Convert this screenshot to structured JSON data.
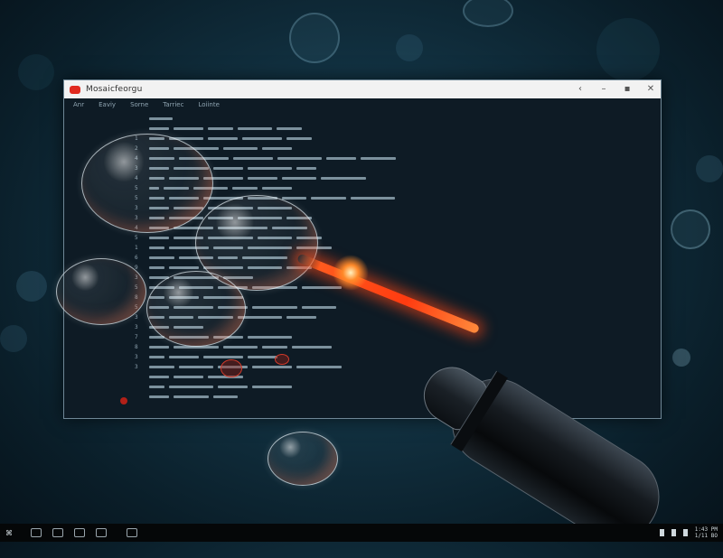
{
  "window": {
    "title": "Mosaicfeorgu",
    "controls": [
      "‹",
      "–",
      "▪",
      "✕"
    ],
    "menu": [
      "Anr",
      "Eaviy",
      "Sorne",
      "Tarriec",
      "Loiinte"
    ],
    "accent": "#e12a1f",
    "background": "#0e1b25"
  },
  "code_lines": [
    {
      "n": "",
      "segs": [
        48
      ]
    },
    {
      "n": "",
      "segs": [
        40,
        60,
        50,
        70,
        50
      ]
    },
    {
      "n": "1",
      "segs": [
        30,
        70,
        60,
        80,
        50
      ]
    },
    {
      "n": "2",
      "segs": [
        40,
        90,
        70,
        60
      ]
    },
    {
      "n": "4",
      "segs": [
        50,
        100,
        80,
        90,
        60,
        70
      ]
    },
    {
      "n": "3",
      "segs": [
        40,
        70,
        60,
        90,
        40
      ]
    },
    {
      "n": "4",
      "segs": [
        30,
        60,
        80,
        60,
        70,
        90
      ]
    },
    {
      "n": "5",
      "segs": [
        20,
        50,
        70,
        50,
        60
      ]
    },
    {
      "n": "5",
      "segs": [
        30,
        60,
        80,
        60,
        50,
        70,
        90
      ]
    },
    {
      "n": "3",
      "segs": [
        40,
        60,
        90,
        70
      ]
    },
    {
      "n": "3",
      "segs": [
        30,
        70,
        50,
        90,
        50
      ]
    },
    {
      "n": "4",
      "segs": [
        40,
        80,
        100,
        70
      ]
    },
    {
      "n": "5",
      "segs": [
        40,
        60,
        90,
        70,
        50
      ]
    },
    {
      "n": "1",
      "segs": [
        30,
        80,
        60,
        90,
        70
      ]
    },
    {
      "n": "6",
      "segs": [
        50,
        70,
        40,
        90
      ]
    },
    {
      "n": "9",
      "segs": [
        30,
        60,
        80,
        70,
        50
      ]
    },
    {
      "n": "3",
      "segs": [
        40,
        90,
        60
      ]
    },
    {
      "n": "5",
      "segs": [
        50,
        70,
        60,
        90,
        80
      ]
    },
    {
      "n": "8",
      "segs": [
        30,
        60,
        80
      ]
    },
    {
      "n": "5",
      "segs": [
        40,
        80,
        60,
        90,
        70
      ]
    },
    {
      "n": "3",
      "segs": [
        30,
        50,
        70,
        90,
        60
      ]
    },
    {
      "n": "3",
      "segs": [
        40,
        60
      ]
    },
    {
      "n": "7",
      "segs": [
        30,
        80,
        60,
        90
      ]
    },
    {
      "n": "8",
      "segs": [
        40,
        90,
        70,
        50,
        80
      ]
    },
    {
      "n": "3",
      "segs": [
        30,
        60,
        80,
        60
      ]
    },
    {
      "n": "3",
      "segs": [
        50,
        70,
        60,
        80,
        90
      ]
    },
    {
      "n": "",
      "segs": [
        40,
        60,
        70
      ]
    },
    {
      "n": "",
      "segs": [
        30,
        90,
        60,
        80
      ]
    },
    {
      "n": "",
      "segs": [
        40,
        70,
        50
      ]
    }
  ],
  "taskbar": {
    "start": "⌘",
    "items": [
      "explorer-icon",
      "mail-icon",
      "folder-icon",
      "terminal-icon",
      "app-icon"
    ],
    "clock_line1": "1:43 PM",
    "clock_line2": "1/11 BO"
  }
}
